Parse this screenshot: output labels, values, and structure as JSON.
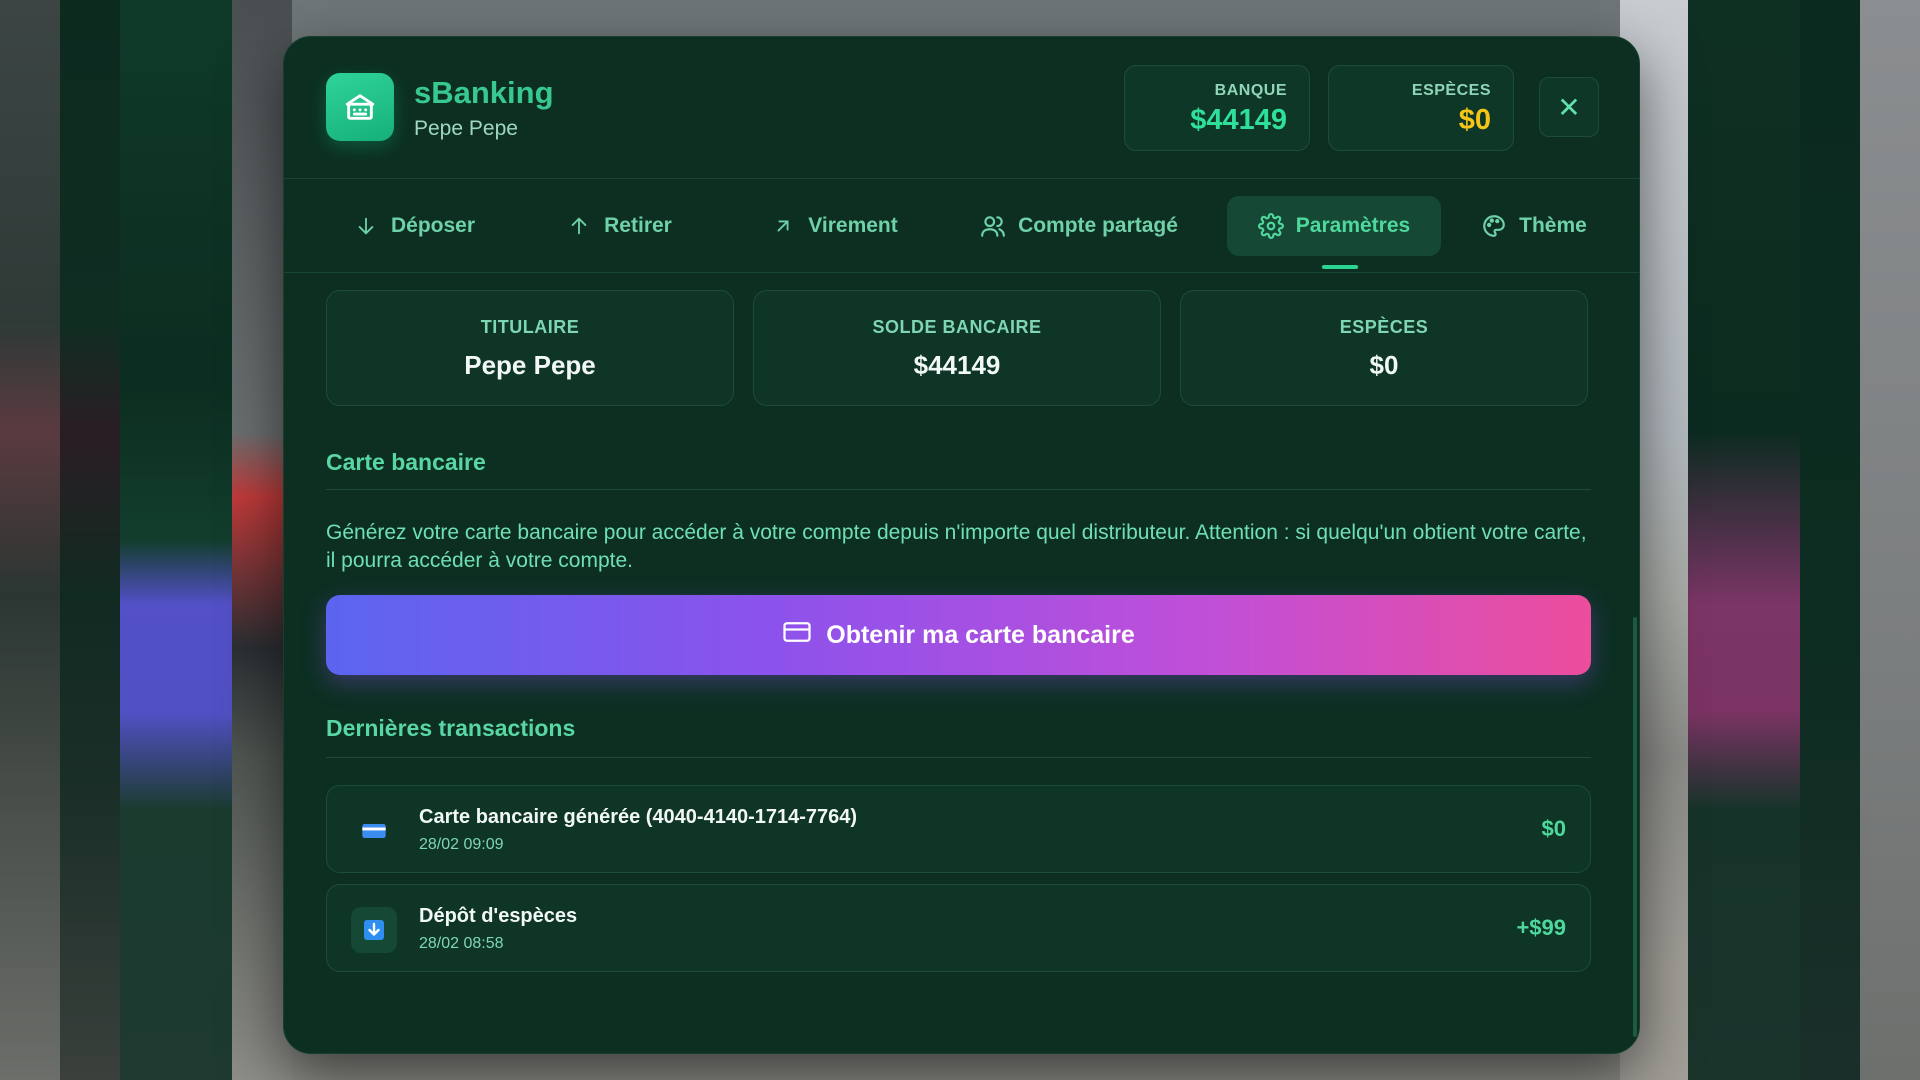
{
  "app": {
    "title": "sBanking",
    "user": "Pepe Pepe",
    "bank_label": "BANQUE",
    "bank_value": "$44149",
    "cash_label": "ESPÈCES",
    "cash_value": "$0",
    "close_glyph": "✕"
  },
  "tabs": [
    {
      "label": "Déposer",
      "icon": "arrow-down-icon"
    },
    {
      "label": "Retirer",
      "icon": "arrow-up-icon"
    },
    {
      "label": "Virement",
      "icon": "arrow-up-right-icon"
    },
    {
      "label": "Compte partagé",
      "icon": "users-icon"
    },
    {
      "label": "Paramètres",
      "icon": "gear-icon",
      "active": true
    },
    {
      "label": "Thème",
      "icon": "palette-icon"
    }
  ],
  "cards": [
    {
      "label": "TITULAIRE",
      "value": "Pepe Pepe"
    },
    {
      "label": "SOLDE BANCAIRE",
      "value": "$44149"
    },
    {
      "label": "ESPÈCES",
      "value": "$0"
    }
  ],
  "bank_card": {
    "title": "Carte bancaire",
    "description": "Générez votre carte bancaire pour accéder à votre compte depuis n'importe quel distributeur. Attention : si quelqu'un obtient votre carte, il pourra accéder à votre compte.",
    "button_label": "Obtenir ma carte bancaire"
  },
  "transactions": {
    "title": "Dernières transactions",
    "items": [
      {
        "title": "Carte bancaire générée (4040-4140-1714-7764)",
        "date": "28/02 09:09",
        "amount": "$0",
        "icon": "credit-card-icon"
      },
      {
        "title": "Dépôt d'espèces",
        "date": "28/02 08:58",
        "amount": "+$99",
        "icon": "download-icon"
      }
    ]
  },
  "colors": {
    "accent": "#2ad592",
    "panel_bg": "#0c2f22",
    "cash_value": "#f5c518",
    "cta_gradient_start": "#5b65ef",
    "cta_gradient_end": "#ec4d9c"
  }
}
